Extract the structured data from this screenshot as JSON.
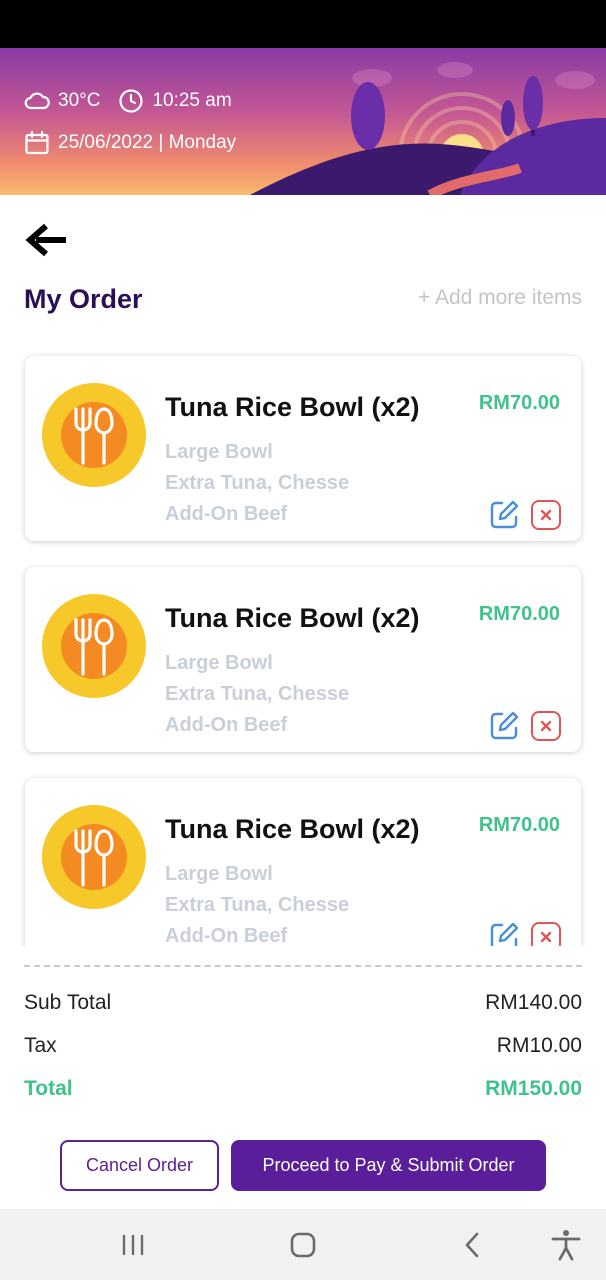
{
  "header": {
    "temperature": "30°C",
    "time": "10:25 am",
    "date": "25/06/2022 | Monday",
    "icons": [
      "cloud-icon",
      "clock-icon",
      "calendar-icon"
    ]
  },
  "page": {
    "title": "My Order",
    "add_more": "+ Add more items"
  },
  "orders": [
    {
      "name": "Tuna Rice Bowl (x2)",
      "price": "RM70.00",
      "options": [
        "Large Bowl",
        "Extra Tuna, Chesse",
        "Add-On Beef"
      ]
    },
    {
      "name": "Tuna Rice Bowl (x2)",
      "price": "RM70.00",
      "options": [
        "Large Bowl",
        "Extra Tuna, Chesse",
        "Add-On Beef"
      ]
    },
    {
      "name": "Tuna Rice Bowl (x2)",
      "price": "RM70.00",
      "options": [
        "Large Bowl",
        "Extra Tuna, Chesse",
        "Add-On Beef"
      ]
    }
  ],
  "summary": {
    "subtotal_label": "Sub Total",
    "subtotal_value": "RM140.00",
    "tax_label": "Tax",
    "tax_value": "RM10.00",
    "total_label": "Total",
    "total_value": "RM150.00"
  },
  "actions": {
    "cancel": "Cancel Order",
    "proceed": "Proceed to Pay & Submit Order"
  },
  "colors": {
    "brand_purple": "#5a1e9a",
    "title_purple": "#2a0f55",
    "price_green": "#3fc38a",
    "muted_text": "#c9cfd8",
    "edit_blue": "#4a8fd6",
    "delete_red": "#e05555"
  },
  "system_nav": [
    "recent-apps-icon",
    "home-icon",
    "back-chevron-icon",
    "accessibility-icon"
  ]
}
